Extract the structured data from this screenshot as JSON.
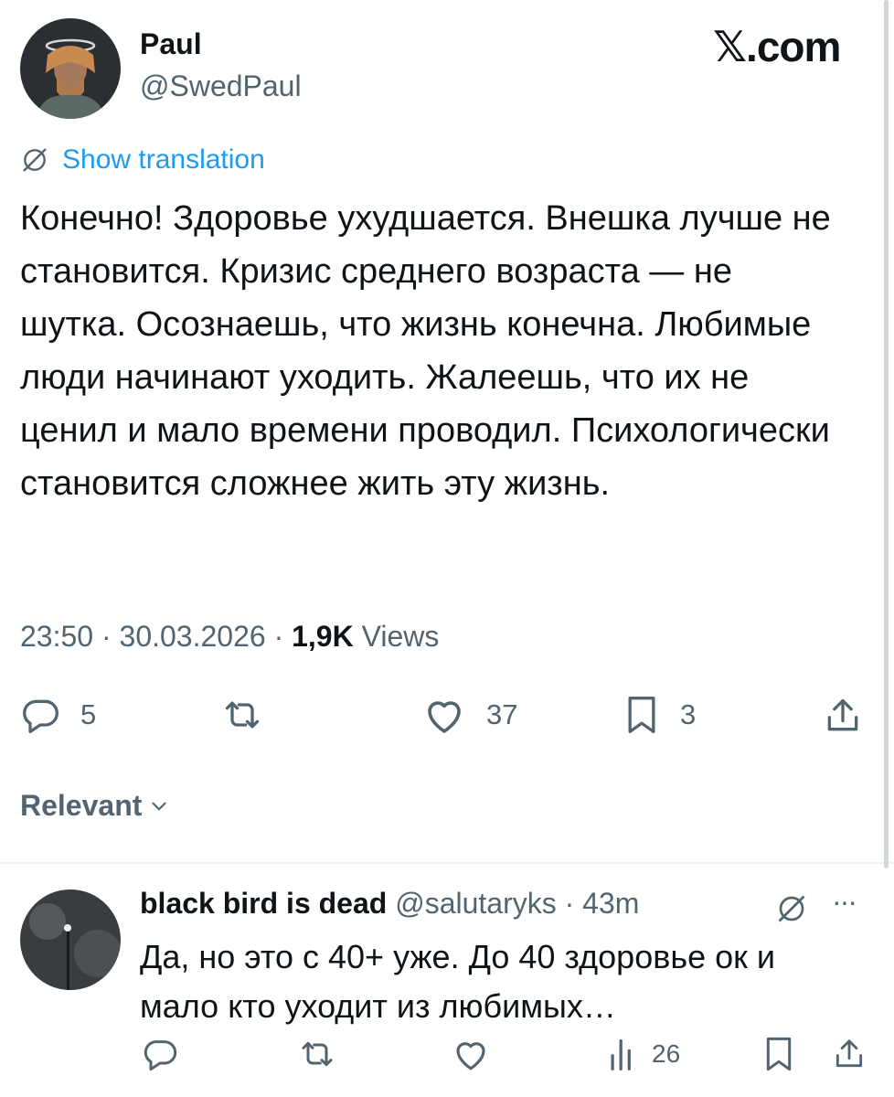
{
  "tweet": {
    "author_name": "Paul",
    "author_handle": "@SwedPaul",
    "brand": "𝕏.com",
    "show_translation": "Show translation",
    "text": "Конечно! Здоровье ухудшается. Внешка лучше не становится. Кризис среднего возраста — не шутка. Осознаешь, что жизнь конечна. Любимые люди начинают уходить. Жалеешь, что их не ценил и мало времени проводил. Психологически становится сложнее жить эту жизнь.",
    "time": "23:50",
    "date": "30.03.2026",
    "separator": "·",
    "views_count": "1,9K",
    "views_label": "Views",
    "replies": "5",
    "likes": "37",
    "bookmarks": "3"
  },
  "sort": {
    "label": "Relevant"
  },
  "reply": {
    "author_name": "black bird is dead",
    "author_handle": "@salutaryks",
    "age": "· 43m",
    "more": "···",
    "text": "Да, но это с 40+ уже. До 40 здоровье ок и мало кто уходит из любимых…",
    "views": "26"
  },
  "colors": {
    "link": "#1d9bf0",
    "muted": "#536471",
    "divider": "#eff3f4",
    "text": "#0f1419"
  },
  "icons": [
    "globe-slash-icon",
    "reply-icon",
    "retweet-icon",
    "heart-icon",
    "bookmark-icon",
    "share-icon",
    "chevron-down-icon",
    "views-icon"
  ]
}
